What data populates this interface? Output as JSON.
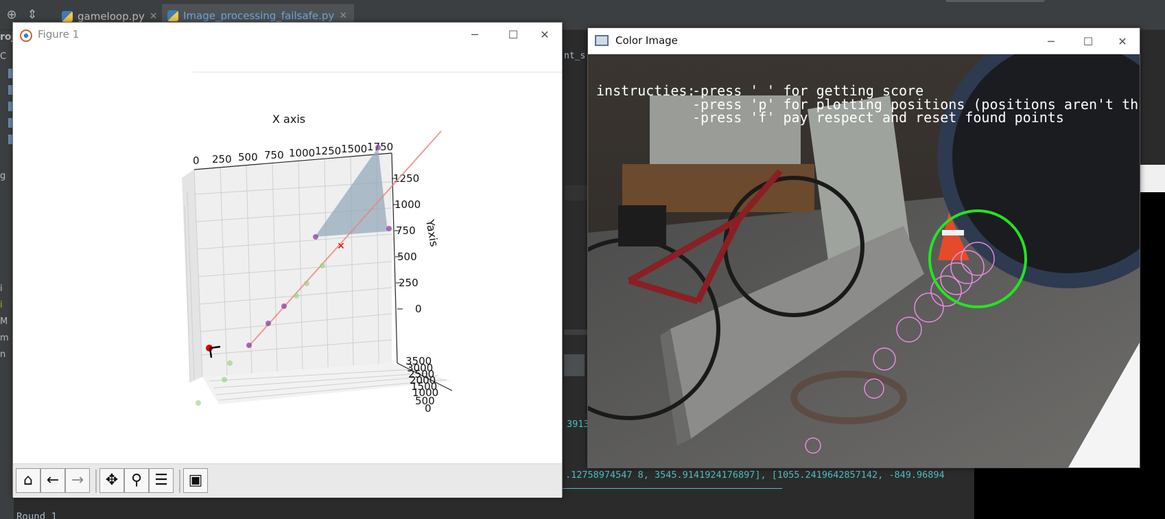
{
  "ide": {
    "tabs": [
      {
        "label": "gameloop.py"
      },
      {
        "label": "Image_processing_failsafe.py"
      }
    ],
    "side_labels": [
      "roj",
      "C",
      "g",
      "i",
      "i",
      "M",
      "m",
      "n"
    ],
    "code_fragment": "nt_s",
    "console": {
      "line_1": "3913",
      "line_2": ".12758974547 8, 3545.9141924176897], [1055.2419642857142, -849.96894",
      "round": "Round 1"
    }
  },
  "figure": {
    "title": "Figure 1",
    "x_axis_label": "X axis",
    "y_axis_label": "Yaxis",
    "x_ticks": [
      "0",
      "250",
      "500",
      "750",
      "1000",
      "1250",
      "1500",
      "1750"
    ],
    "y_ticks": [
      "1250",
      "1000",
      "750",
      "500",
      "250",
      "0"
    ],
    "z_ticks": [
      "3500",
      "3000",
      "2500",
      "2000",
      "1500",
      "1000",
      "500",
      "0"
    ],
    "toolbar": {
      "home": "home-icon",
      "back": "arrow-left-icon",
      "forward": "arrow-right-icon",
      "pan": "move-icon",
      "zoom": "zoom-icon",
      "configure": "sliders-icon",
      "save": "save-icon"
    }
  },
  "color_image": {
    "title": "Color Image",
    "overlay": {
      "label": "instructies:",
      "line_1": "-press ' ' for getting score",
      "line_2": "-press 'p' for plotting positions (positions aren't thrown away)",
      "line_3": "-press 'f' pay respect and reset found points"
    },
    "colors": {
      "target_circle": "#22e61e",
      "trail_circles": "#e88ae0"
    }
  },
  "colors": {
    "ide_bg": "#2b2b2b",
    "ide_panel": "#3c3f41",
    "console_text": "#4dbfc4",
    "plot_line": "#f08080",
    "plane": "#8fa5b8",
    "purple_point": "#8e3fa0",
    "green_point": "#8fce7a",
    "red_marker": "#e00000"
  }
}
